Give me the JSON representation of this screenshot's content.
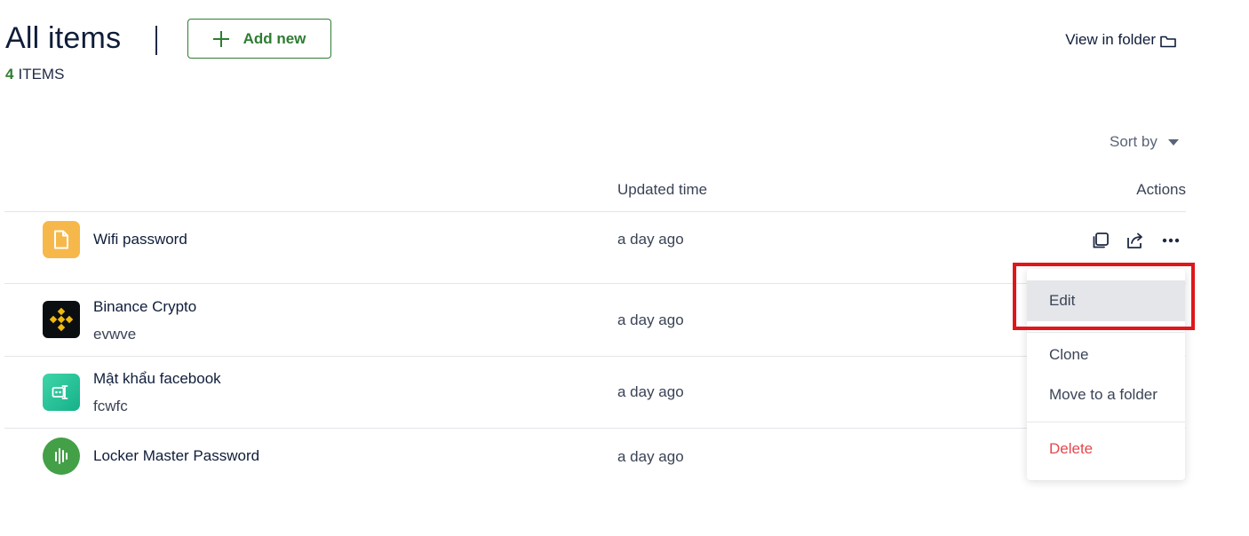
{
  "header": {
    "title": "All items",
    "add_new_label": "Add new",
    "item_count": "4",
    "item_count_label": "ITEMS",
    "view_in_folder_label": "View in folder"
  },
  "toolbar": {
    "sort_by_label": "Sort by"
  },
  "table": {
    "columns": {
      "updated": "Updated time",
      "actions": "Actions"
    },
    "rows": [
      {
        "title": "Wifi password",
        "subtitle": "",
        "updated": "a day ago",
        "icon": "file-icon"
      },
      {
        "title": "Binance Crypto",
        "subtitle": "evwve",
        "updated": "a day ago",
        "icon": "binance-logo-icon"
      },
      {
        "title": "Mật khẩu facebook",
        "subtitle": "fcwfc",
        "updated": "a day ago",
        "icon": "password-card-icon"
      },
      {
        "title": "Locker Master Password",
        "subtitle": "",
        "updated": "a day ago",
        "icon": "locker-logo-icon"
      }
    ]
  },
  "context_menu": {
    "items": [
      {
        "label": "Edit"
      },
      {
        "label": "Clone"
      },
      {
        "label": "Move to a folder"
      },
      {
        "label": "Delete"
      }
    ]
  },
  "colors": {
    "accent_green": "#2e7d32",
    "danger_red": "#e5484d",
    "highlight_red": "#e0161b"
  }
}
